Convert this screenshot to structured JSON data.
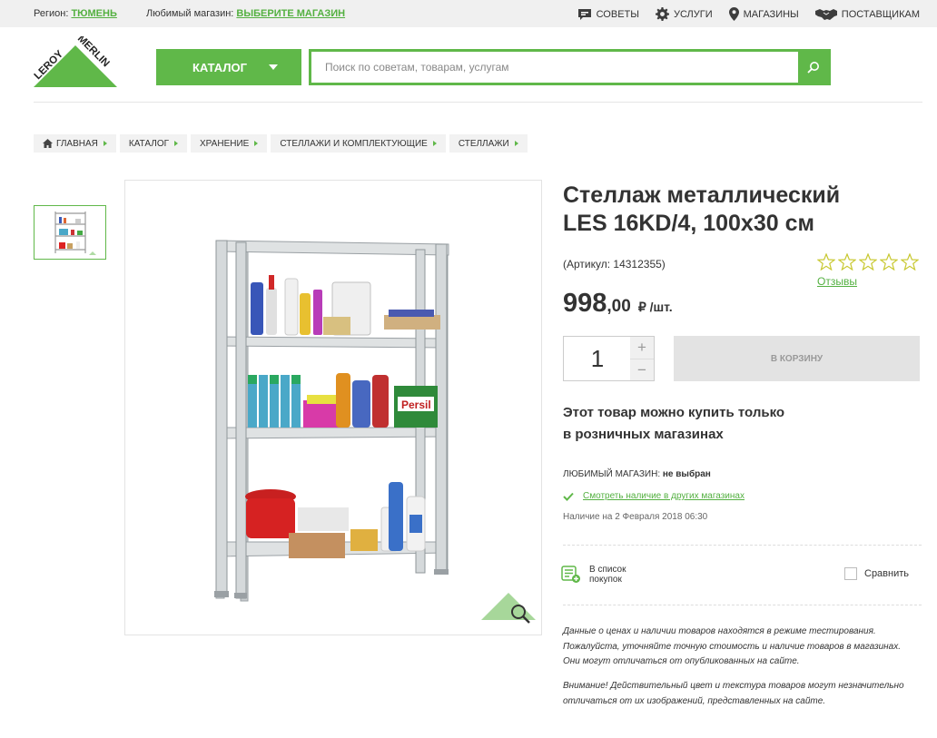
{
  "topbar": {
    "region_label": "Регион:",
    "region_value": "ТЮМЕНЬ",
    "fav_store_label": "Любимый магазин:",
    "fav_store_value": "ВЫБЕРИТЕ МАГАЗИН",
    "links": [
      {
        "label": "Советы",
        "icon": "chat-icon"
      },
      {
        "label": "Услуги",
        "icon": "gear-icon"
      },
      {
        "label": "Магазины",
        "icon": "map-pin-icon"
      },
      {
        "label": "Поставщикам",
        "icon": "handshake-icon"
      }
    ]
  },
  "header": {
    "logo_text_1": "LEROY",
    "logo_text_2": "MERLIN",
    "catalog_label": "КАТАЛОГ",
    "search_placeholder": "Поиск по советам, товарам, услугам"
  },
  "breadcrumbs": [
    "ГЛАВНАЯ",
    "КАТАЛОГ",
    "ХРАНЕНИЕ",
    "СТЕЛЛАЖИ И КОМПЛЕКТУЮЩИЕ",
    "СТЕЛЛАЖИ"
  ],
  "product": {
    "title_line1": "Стеллаж металлический",
    "title_line2": "LES 16KD/4, 100x30 см",
    "sku": "(Артикул: 14312355)",
    "rating_stars": 0,
    "reviews_label": "Отзывы",
    "price_whole": "998",
    "price_cents": ",00",
    "price_unit": "₽ /шт.",
    "quantity": "1",
    "plus": "+",
    "minus": "−",
    "cart_label": "В КОРЗИНУ",
    "note_line1": "Этот товар можно купить только",
    "note_line2": "в розничных магазинах",
    "fav_store_label": "ЛЮБИМЫЙ МАГАЗИН:",
    "fav_store_value": "не выбран",
    "check_other_stores": "Смотреть наличие в других магазинах",
    "availability_date": "Наличие на 2 Февраля 2018 06:30",
    "shopping_list_line1": "В список",
    "shopping_list_line2": "покупок",
    "compare_label": "Сравнить",
    "disclaimer_1": "Данные о ценах и наличии товаров находятся в режиме тестирования. Пожалуйста, уточняйте точную стоимость и наличие товаров в магазинах. Они могут отличаться от опубликованных на сайте.",
    "disclaimer_2": "Внимание! Действительный цвет и текстура товаров могут незначительно отличаться от их изображений, представленных на сайте."
  },
  "colors": {
    "brand_green": "#60b849",
    "text": "#333333",
    "cart_disabled": "#e3e3e3"
  }
}
